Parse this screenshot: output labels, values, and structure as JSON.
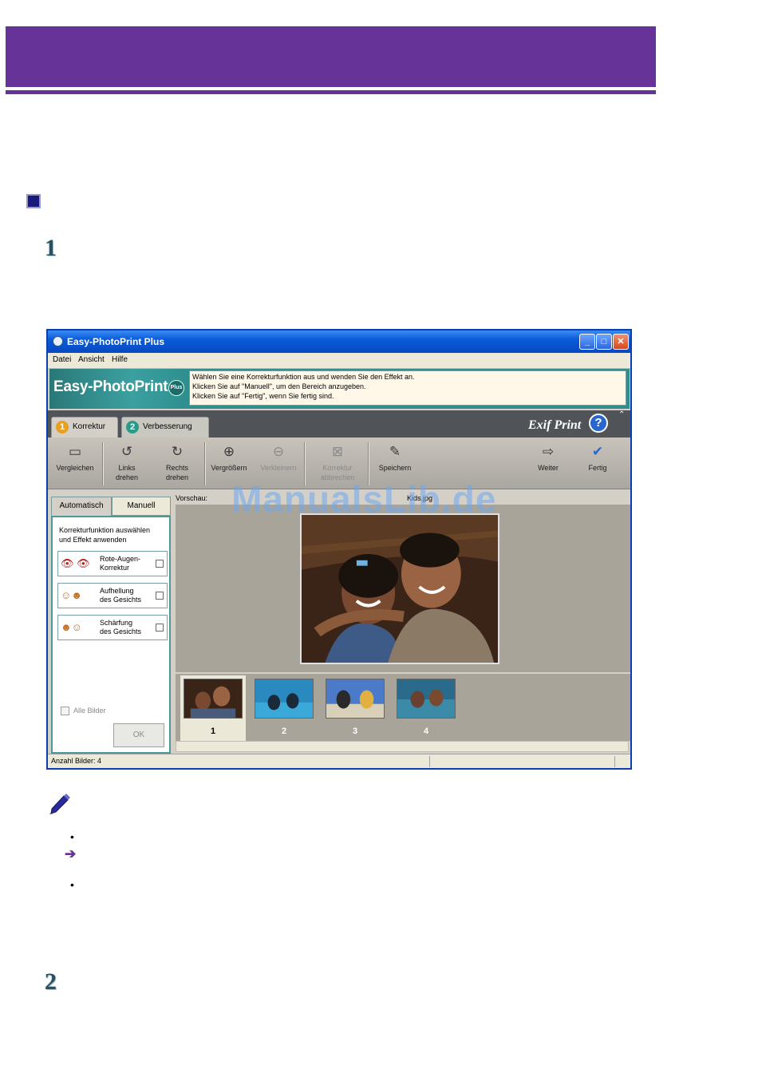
{
  "doc": {
    "step_numbers": [
      "1",
      "2"
    ],
    "bullets": [
      "•",
      "•"
    ],
    "arrow": "➔"
  },
  "window": {
    "title": "Easy-PhotoPrint Plus",
    "controls": {
      "minimize": "_",
      "maximize": "□",
      "close": "✕"
    },
    "menu": [
      "Datei",
      "Ansicht",
      "Hilfe"
    ],
    "header": {
      "logo": "Easy-PhotoPrint",
      "logo_badge": "Plus",
      "instructions": [
        "Wählen Sie eine Korrekturfunktion aus und wenden Sie den Effekt an.",
        "Klicken Sie auf \"Manuell\", um den Bereich anzugeben.",
        "Klicken Sie auf \"Fertig\", wenn Sie fertig sind."
      ]
    },
    "tabs": [
      {
        "num": "1",
        "label": "Korrektur",
        "active": true
      },
      {
        "num": "2",
        "label": "Verbesserung",
        "active": false
      }
    ],
    "exif_logo": "Exif Print",
    "help": "?",
    "collapse": "⌃",
    "toolbar": [
      {
        "icon": "compare-icon",
        "glyph": "▭",
        "label1": "Vergleichen",
        "label2": "",
        "disabled": false
      },
      {
        "icon": "rotate-left-icon",
        "glyph": "↺",
        "label1": "Links",
        "label2": "drehen",
        "disabled": false
      },
      {
        "icon": "rotate-right-icon",
        "glyph": "↻",
        "label1": "Rechts",
        "label2": "drehen",
        "disabled": false
      },
      {
        "icon": "zoom-in-icon",
        "glyph": "⊕",
        "label1": "Vergrößern",
        "label2": "",
        "disabled": false
      },
      {
        "icon": "zoom-out-icon",
        "glyph": "⊖",
        "label1": "Verkleinern",
        "label2": "",
        "disabled": true
      },
      {
        "icon": "undo-correction-icon",
        "glyph": "⊠",
        "label1": "Korrektur",
        "label2": "abbrechen",
        "disabled": true
      },
      {
        "icon": "save-icon",
        "glyph": "✎",
        "label1": "Speichern",
        "label2": "",
        "disabled": false
      },
      {
        "icon": "next-arrow-icon",
        "glyph": "⇨",
        "label1": "Weiter",
        "label2": "",
        "disabled": false
      },
      {
        "icon": "done-check-icon",
        "glyph": "✔",
        "label1": "Fertig",
        "label2": "",
        "disabled": false
      }
    ],
    "left_panel": {
      "tab_auto": "Automatisch",
      "tab_manual": "Manuell",
      "intro": [
        "Korrekturfunktion auswählen",
        "und Effekt anwenden"
      ],
      "features": [
        {
          "icon": "red-eye-icon",
          "glyph": "👁 👁",
          "line1": "Rote-Augen-",
          "line2": "Korrektur"
        },
        {
          "icon": "face-brighten-icon",
          "glyph": "☺☻",
          "line1": "Aufhellung",
          "line2": "des Gesichts"
        },
        {
          "icon": "face-sharpen-icon",
          "glyph": "☻☺",
          "line1": "Schärfung",
          "line2": "des Gesichts"
        }
      ],
      "all_images": "Alle Bilder",
      "ok": "OK"
    },
    "preview": {
      "label": "Vorschau:",
      "filename": "Kids.jpg"
    },
    "thumbnails": [
      {
        "num": "1",
        "selected": true
      },
      {
        "num": "2",
        "selected": false
      },
      {
        "num": "3",
        "selected": false
      },
      {
        "num": "4",
        "selected": false
      }
    ],
    "status": "Anzahl Bilder: 4"
  },
  "watermark": "ManualsLib.de",
  "colors": {
    "banner": "#663399",
    "titlebar": "#0a5bd8",
    "header": "#2f8f8f"
  }
}
